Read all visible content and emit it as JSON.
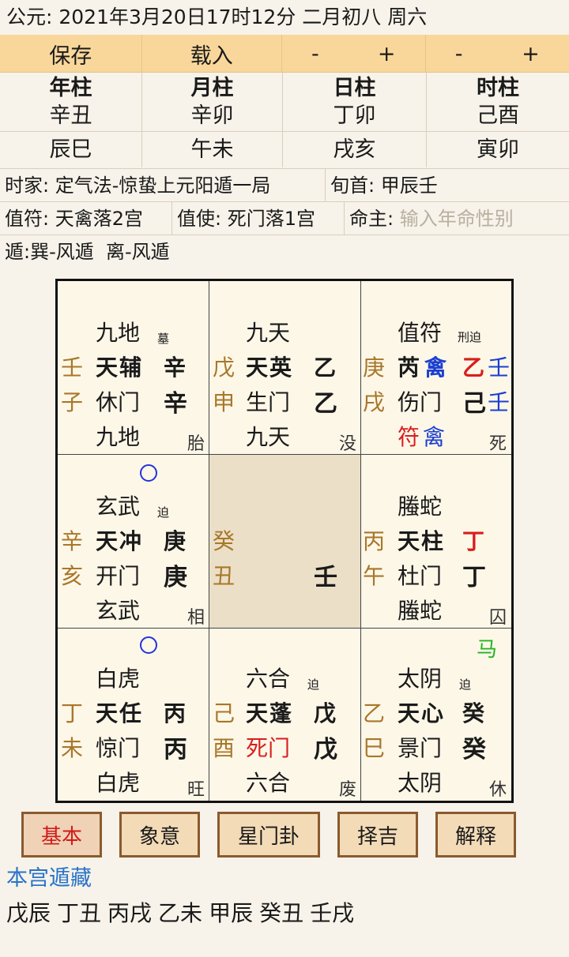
{
  "header": {
    "date_line": "公元: 2021年3月20日17时12分 二月初八 周六"
  },
  "toolbar": {
    "save_label": "保存",
    "load_label": "载入",
    "day_minus": "-",
    "day_plus": "+",
    "hour_minus": "-",
    "hour_plus": "+"
  },
  "pillars": [
    {
      "head": "年柱",
      "ganzhi": "辛丑",
      "kongwang": "辰巳"
    },
    {
      "head": "月柱",
      "ganzhi": "辛卯",
      "kongwang": "午未"
    },
    {
      "head": "日柱",
      "ganzhi": "丁卯",
      "kongwang": "戌亥"
    },
    {
      "head": "时柱",
      "ganzhi": "己酉",
      "kongwang": "寅卯"
    }
  ],
  "info": {
    "shijia": "时家: 定气法-惊蛰上元阳遁一局",
    "xunshou": "旬首: 甲辰壬",
    "zhifu": "值符: 天禽落2宫",
    "zhishi": "值使: 死门落1宫",
    "mingzhu_label": "命主:",
    "mingzhu_placeholder": "输入年命性别",
    "dun": "遁:巽-风遁  离-风遁"
  },
  "palaces": {
    "p4": {
      "side1": "壬",
      "side2": "子",
      "god": "九地",
      "note": "墓",
      "star": "天辅",
      "star_stem": "辛",
      "door": "休门",
      "door_stem": "辛",
      "bottom": "九地",
      "state": "胎"
    },
    "p9": {
      "side1": "戊",
      "side2": "申",
      "god": "九天",
      "star": "天英",
      "star_stem": "乙",
      "door": "生门",
      "door_stem": "乙",
      "bottom": "九天",
      "state": "没"
    },
    "p2": {
      "side1": "庚",
      "side2": "戌",
      "god": "值符",
      "note": "刑迫",
      "star_a": "芮",
      "star_b": "禽",
      "star_stem_a": "乙",
      "star_stem_b": "壬",
      "door": "伤门",
      "door_stem_a": "己",
      "door_stem_b": "壬",
      "bottom_a": "符",
      "bottom_b": "禽",
      "state": "死"
    },
    "p3": {
      "side1": "辛",
      "side2": "亥",
      "god": "玄武",
      "note": "迫",
      "star": "天冲",
      "star_stem": "庚",
      "door": "开门",
      "door_stem": "庚",
      "bottom": "玄武",
      "state": "相"
    },
    "p5": {
      "side1": "癸",
      "side2": "丑",
      "stem": "壬"
    },
    "p7": {
      "side1": "丙",
      "side2": "午",
      "god": "螣蛇",
      "star": "天柱",
      "star_stem": "丁",
      "door": "杜门",
      "door_stem": "丁",
      "bottom": "螣蛇",
      "state": "囚"
    },
    "p8": {
      "side1": "丁",
      "side2": "未",
      "god": "白虎",
      "star": "天任",
      "star_stem": "丙",
      "door": "惊门",
      "door_stem": "丙",
      "bottom": "白虎",
      "state": "旺"
    },
    "p1": {
      "side1": "己",
      "side2": "酉",
      "god": "六合",
      "note": "迫",
      "star": "天蓬",
      "star_stem": "戊",
      "door": "死门",
      "door_stem": "戊",
      "bottom": "六合",
      "state": "废"
    },
    "p6": {
      "side1": "乙",
      "side2": "巳",
      "god": "太阴",
      "note": "迫",
      "extra": "马",
      "star": "天心",
      "star_stem": "癸",
      "door": "景门",
      "door_stem": "癸",
      "bottom": "太阴",
      "state": "休"
    }
  },
  "buttons": [
    "基本",
    "象意",
    "星门卦",
    "择吉",
    "解释"
  ],
  "hidden": {
    "title": "本宫遁藏",
    "items": [
      "戊辰",
      "丁丑",
      "丙戌",
      "乙未",
      "甲辰",
      "癸丑",
      "壬戌"
    ]
  },
  "colors": {
    "toolbar_bg": "#f9d79b",
    "board_bg": "#fdf7e8",
    "center_bg": "#ebdfc8",
    "accent_red": "#d81e1e",
    "accent_blue": "#1b3fd0",
    "link_blue": "#2a73c9"
  }
}
